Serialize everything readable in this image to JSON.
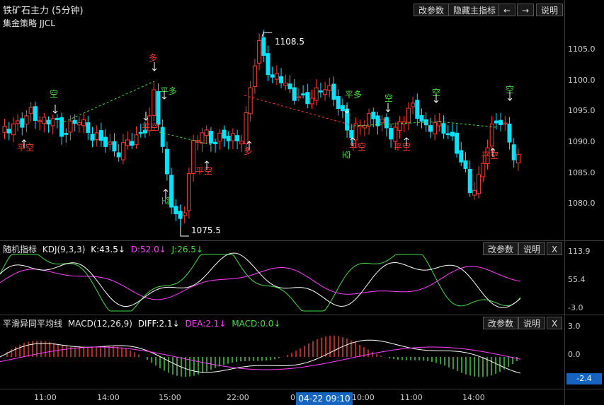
{
  "header": {
    "title": "铁矿石主力 (5分钟)",
    "strategy": "集金策略 JJCL",
    "btn_params": "改参数",
    "btn_hide": "隐藏主指标",
    "btn_left": "←",
    "btn_right": "→",
    "btn_help": "说明"
  },
  "main_axis": {
    "ticks": [
      "1105.0",
      "1100.0",
      "1095.0",
      "1090.0",
      "1085.0",
      "1080.0"
    ],
    "high_label": "1108.5",
    "low_label": "1075.5"
  },
  "signals": {
    "duo": "多",
    "kong": "空",
    "pingkong": "平空",
    "pingduo": "平多"
  },
  "kdj": {
    "name": "随机指标",
    "params": "KDJ(9,3,3)",
    "k": "K:43.5↓",
    "d": "D:52.0↓",
    "j": "J:26.5↓",
    "btn_params": "改参数",
    "btn_help": "说明",
    "btn_close": "X",
    "ticks": [
      "113.9",
      "55.4",
      "-3.0"
    ]
  },
  "macd": {
    "name": "平滑异同平均线",
    "params": "MACD(12,26,9)",
    "diff": "DIFF:2.1↓",
    "dea": "DEA:2.1↓",
    "macd": "MACD:0.0↓",
    "btn_params": "改参数",
    "btn_help": "说明",
    "btn_close": "X",
    "ticks": [
      "3.0",
      "0.0"
    ],
    "current": "-2.4"
  },
  "time_axis": {
    "labels": [
      "11:00",
      "14:00",
      "15:00",
      "22:00",
      "0",
      "10:00",
      "11:00",
      "14:00"
    ],
    "cursor": "04-22 09:10"
  },
  "colors": {
    "up": "#ff3b30",
    "down": "#00e5ff",
    "kdj_k": "#ffffff",
    "kdj_d": "#ff40ff",
    "kdj_j": "#44dd44",
    "accent": "#1565c0"
  }
}
